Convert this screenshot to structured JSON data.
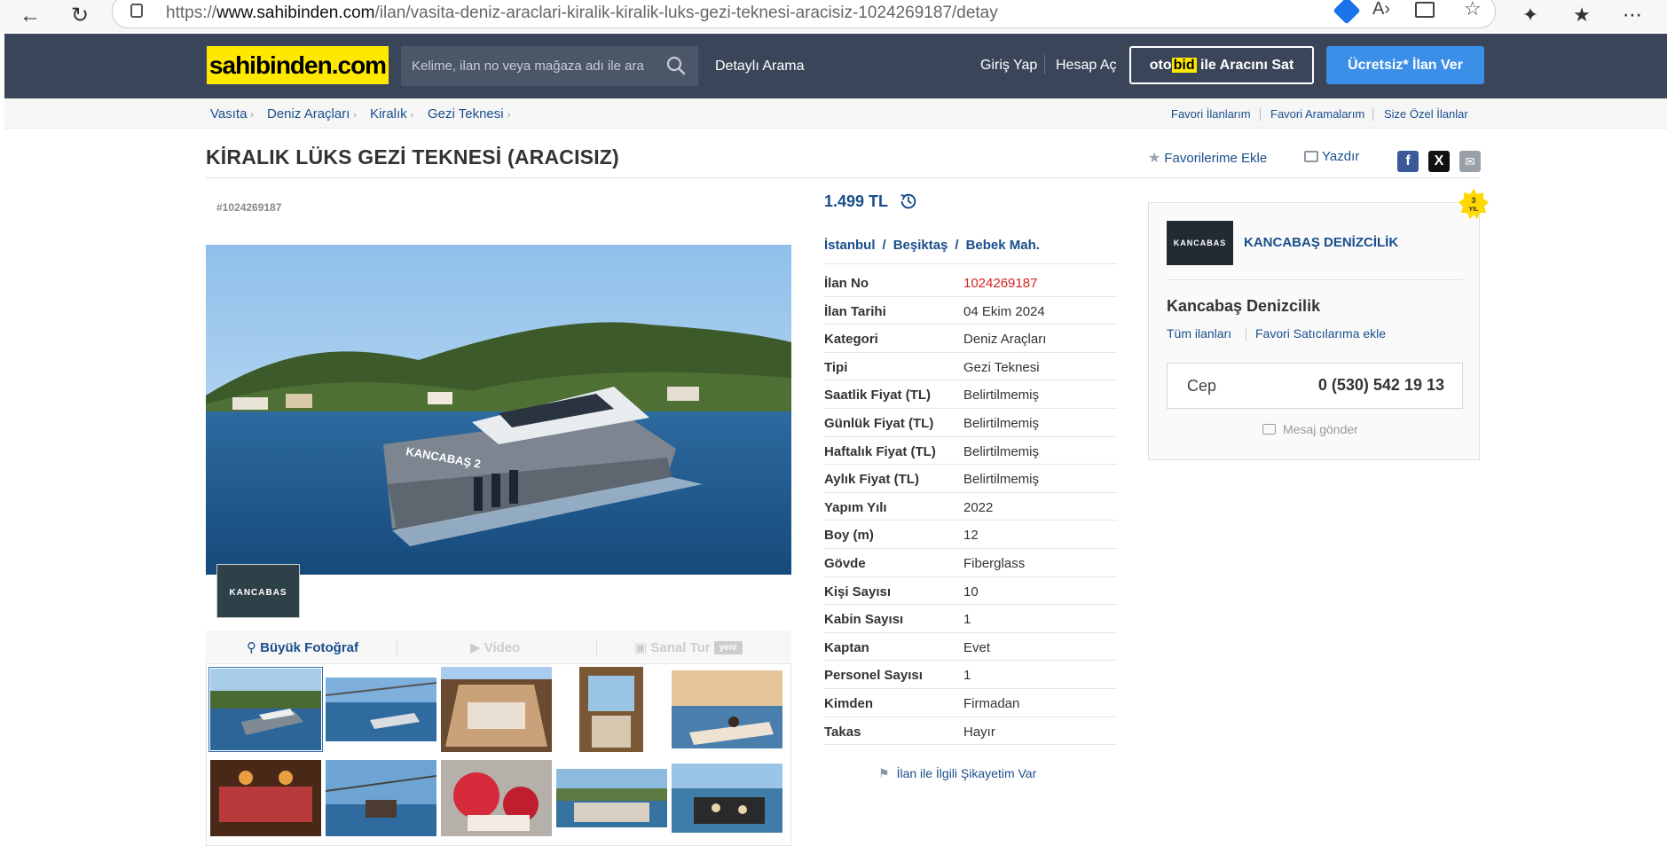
{
  "browser": {
    "url_prefix": "https://",
    "url_domain": "www.sahibinden.com",
    "url_path": "/ilan/vasita-deniz-araclari-kiralik-kiralik-luks-gezi-teknesi-aracisiz-1024269187/detay"
  },
  "header": {
    "logo": "sahibinden.com",
    "search_placeholder": "Kelime, ilan no veya mağaza adı ile ara",
    "detailed_search": "Detaylı Arama",
    "login": "Giriş Yap",
    "register": "Hesap Aç",
    "otobid_oto": "oto",
    "otobid_bid": "bid",
    "otobid_rest": " ile Aracını Sat",
    "post_ad": "Ücretsiz* İlan Ver"
  },
  "breadcrumb": [
    "Vasıta",
    "Deniz Araçları",
    "Kiralık",
    "Gezi Teknesi"
  ],
  "top_links": [
    "Favori İlanlarım",
    "Favori Aramalarım",
    "Size Özel İlanlar"
  ],
  "listing": {
    "title": "KİRALIK LÜKS GEZİ TEKNESİ (ARACISIZ)",
    "fav_add": "Favorilerime Ekle",
    "print": "Yazdır",
    "id_label": "#1024269187",
    "price": "1.499 TL",
    "location": [
      "İstanbul",
      "Beşiktaş",
      "Bebek Mah."
    ],
    "complaint": "İlan ile İlgili Şikayetim Var"
  },
  "gallery": {
    "tab_big_photo": "Büyük Fotoğraf",
    "tab_video": "Video",
    "tab_virtual_tour": "Sanal Tur",
    "badge_new": "yeni",
    "boat_name": "KANCABAŞ 2",
    "watermark": "KANCABAS"
  },
  "attributes": [
    {
      "label": "İlan No",
      "value": "1024269187"
    },
    {
      "label": "İlan Tarihi",
      "value": "04 Ekim 2024"
    },
    {
      "label": "Kategori",
      "value": "Deniz Araçları"
    },
    {
      "label": "Tipi",
      "value": "Gezi Teknesi"
    },
    {
      "label": "Saatlik Fiyat (TL)",
      "value": "Belirtilmemiş"
    },
    {
      "label": "Günlük Fiyat (TL)",
      "value": "Belirtilmemiş"
    },
    {
      "label": "Haftalık Fiyat (TL)",
      "value": "Belirtilmemiş"
    },
    {
      "label": "Aylık Fiyat (TL)",
      "value": "Belirtilmemiş"
    },
    {
      "label": "Yapım Yılı",
      "value": "2022"
    },
    {
      "label": "Boy (m)",
      "value": "12"
    },
    {
      "label": "Gövde",
      "value": "Fiberglass"
    },
    {
      "label": "Kişi Sayısı",
      "value": "10"
    },
    {
      "label": "Kabin Sayısı",
      "value": "1"
    },
    {
      "label": "Kaptan",
      "value": "Evet"
    },
    {
      "label": "Personel Sayısı",
      "value": "1"
    },
    {
      "label": "Kimden",
      "value": "Firmadan"
    },
    {
      "label": "Takas",
      "value": "Hayır"
    }
  ],
  "seller": {
    "year_badge_num": "3",
    "year_badge_text": "YIL",
    "logo_text": "KANCABAS",
    "store_name": "KANCABAŞ DENİZCİLİK",
    "name": "Kancabaş Denizcilik",
    "all_listings": "Tüm ilanları",
    "add_fav_seller": "Favori Satıcılarıma ekle",
    "phone_label": "Cep",
    "phone": "0 (530) 542 19 13",
    "message": "Mesaj gönder"
  },
  "colors": {
    "header_bg": "#3a4559",
    "logo_yellow": "#ffe800",
    "link_blue": "#1a4e8c",
    "cta_blue": "#3b8fe8",
    "id_red": "#d51f1f"
  }
}
